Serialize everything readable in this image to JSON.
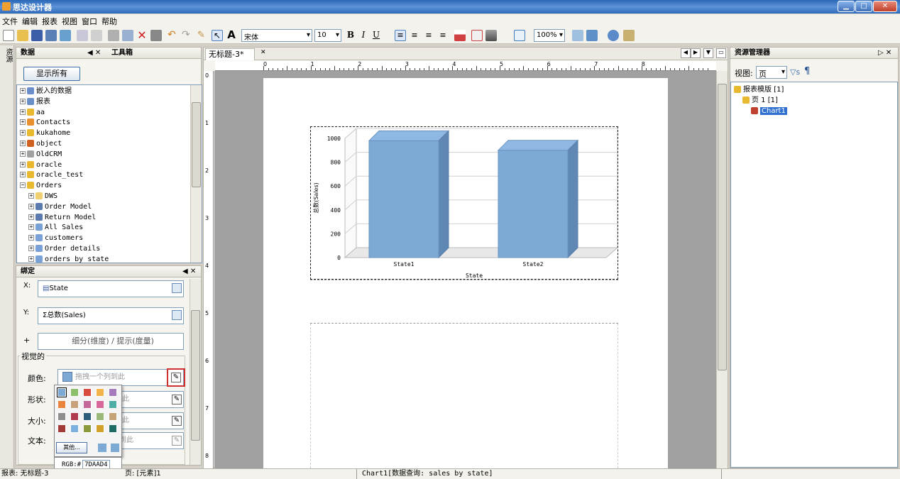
{
  "window": {
    "title": "思达设计器",
    "min": "▁",
    "max": "□",
    "close": "✕"
  },
  "menu": [
    "文件",
    "编辑",
    "报表",
    "视图",
    "窗口",
    "帮助"
  ],
  "toolbar": {
    "font": "宋体",
    "size": "10",
    "bold": "B",
    "italic": "I",
    "underline": "U",
    "zoom": "100%",
    "text_tool": "A"
  },
  "left_tabs": {
    "data": "数据",
    "tools": "工具箱",
    "side_label": "资源"
  },
  "data_panel": {
    "show_all": "显示所有",
    "tree": [
      {
        "label": "嵌入的数据",
        "indent": 0,
        "color": "#6a8ec8"
      },
      {
        "label": "报表",
        "indent": 0,
        "color": "#6a8ec8"
      },
      {
        "label": "aa",
        "indent": 0,
        "color": "#e8b830"
      },
      {
        "label": "Contacts",
        "indent": 0,
        "color": "#e89030"
      },
      {
        "label": "kukahome",
        "indent": 0,
        "color": "#e8b830"
      },
      {
        "label": "object",
        "indent": 0,
        "color": "#d06020"
      },
      {
        "label": "OldCRM",
        "indent": 0,
        "color": "#a0a0a0"
      },
      {
        "label": "oracle",
        "indent": 0,
        "color": "#e8b830"
      },
      {
        "label": "oracle_test",
        "indent": 0,
        "color": "#e8b830"
      },
      {
        "label": "Orders",
        "indent": 0,
        "color": "#e8b830"
      },
      {
        "label": "DWS",
        "indent": 1,
        "color": "#f0d070"
      },
      {
        "label": "Order Model",
        "indent": 1,
        "color": "#5a7ab0"
      },
      {
        "label": "Return Model",
        "indent": 1,
        "color": "#5a7ab0"
      },
      {
        "label": "All Sales",
        "indent": 1,
        "color": "#7aa0d8"
      },
      {
        "label": "customers",
        "indent": 1,
        "color": "#7aa0d8"
      },
      {
        "label": "Order details",
        "indent": 1,
        "color": "#7aa0d8"
      },
      {
        "label": "orders by state",
        "indent": 1,
        "color": "#7aa0d8"
      }
    ]
  },
  "binding": {
    "title": "绑定",
    "x_label": "X:",
    "x_value": "State",
    "y_label": "Y:",
    "y_value": "总数(Sales)",
    "plus": "+",
    "detail_hint": "细分(维度) / 提示(度量)",
    "visual_title": "视觉的",
    "color_label": "颜色:",
    "color_hint": "拖拽一个列到此",
    "shape_label": "形状:",
    "size_label": "大小:",
    "text_label": "文本:",
    "hint_tail_shape": "此",
    "hint_tail_size": "此",
    "hint_tail_text": "到此",
    "palette": [
      "#7DAAD4",
      "#8dc06a",
      "#d64b3e",
      "#f2b34a",
      "#a57bbd",
      "#e8843e",
      "#c8a27a",
      "#c4689c",
      "#d7679b",
      "#4eada5",
      "#8e8e8e",
      "#b23c4f",
      "#2d5f7a",
      "#9ab87a",
      "#c4a477",
      "#a23a3a",
      "#7db0e0",
      "#8a9a3c",
      "#d4a02c",
      "#1e6b66"
    ],
    "more": "其他...",
    "rgb_label": "RGB:#",
    "rgb_value": "7DAAD4"
  },
  "editor": {
    "tab": "无标题-3*",
    "ruler_top": [
      "0",
      "1",
      "2",
      "3",
      "4",
      "5",
      "6",
      "7",
      "8"
    ],
    "ruler_left": [
      "0",
      "1",
      "2",
      "3",
      "4",
      "5",
      "6",
      "7",
      "8"
    ]
  },
  "chart_data": {
    "type": "bar",
    "categories": [
      "State1",
      "State2"
    ],
    "values": [
      980,
      900
    ],
    "xlabel": "State",
    "ylabel": "总数(Sales)",
    "ylim": [
      0,
      1000
    ],
    "yticks": [
      "1000",
      "800",
      "600",
      "400",
      "200",
      "0"
    ],
    "bar_color": "#7DAAD4",
    "grid": true
  },
  "resource_panel": {
    "title": "资源管理器",
    "view_label": "视图:",
    "view_value": "页",
    "tree": [
      {
        "label": "报表模版 [1]",
        "indent": 0
      },
      {
        "label": "页 1  [1]",
        "indent": 1
      },
      {
        "label": "Chart1",
        "indent": 2
      }
    ]
  },
  "status": {
    "left": "报表: 无标题-3",
    "mid_frag": "页: [元素]1",
    "center": "Chart1[数据查询: sales by state]"
  }
}
